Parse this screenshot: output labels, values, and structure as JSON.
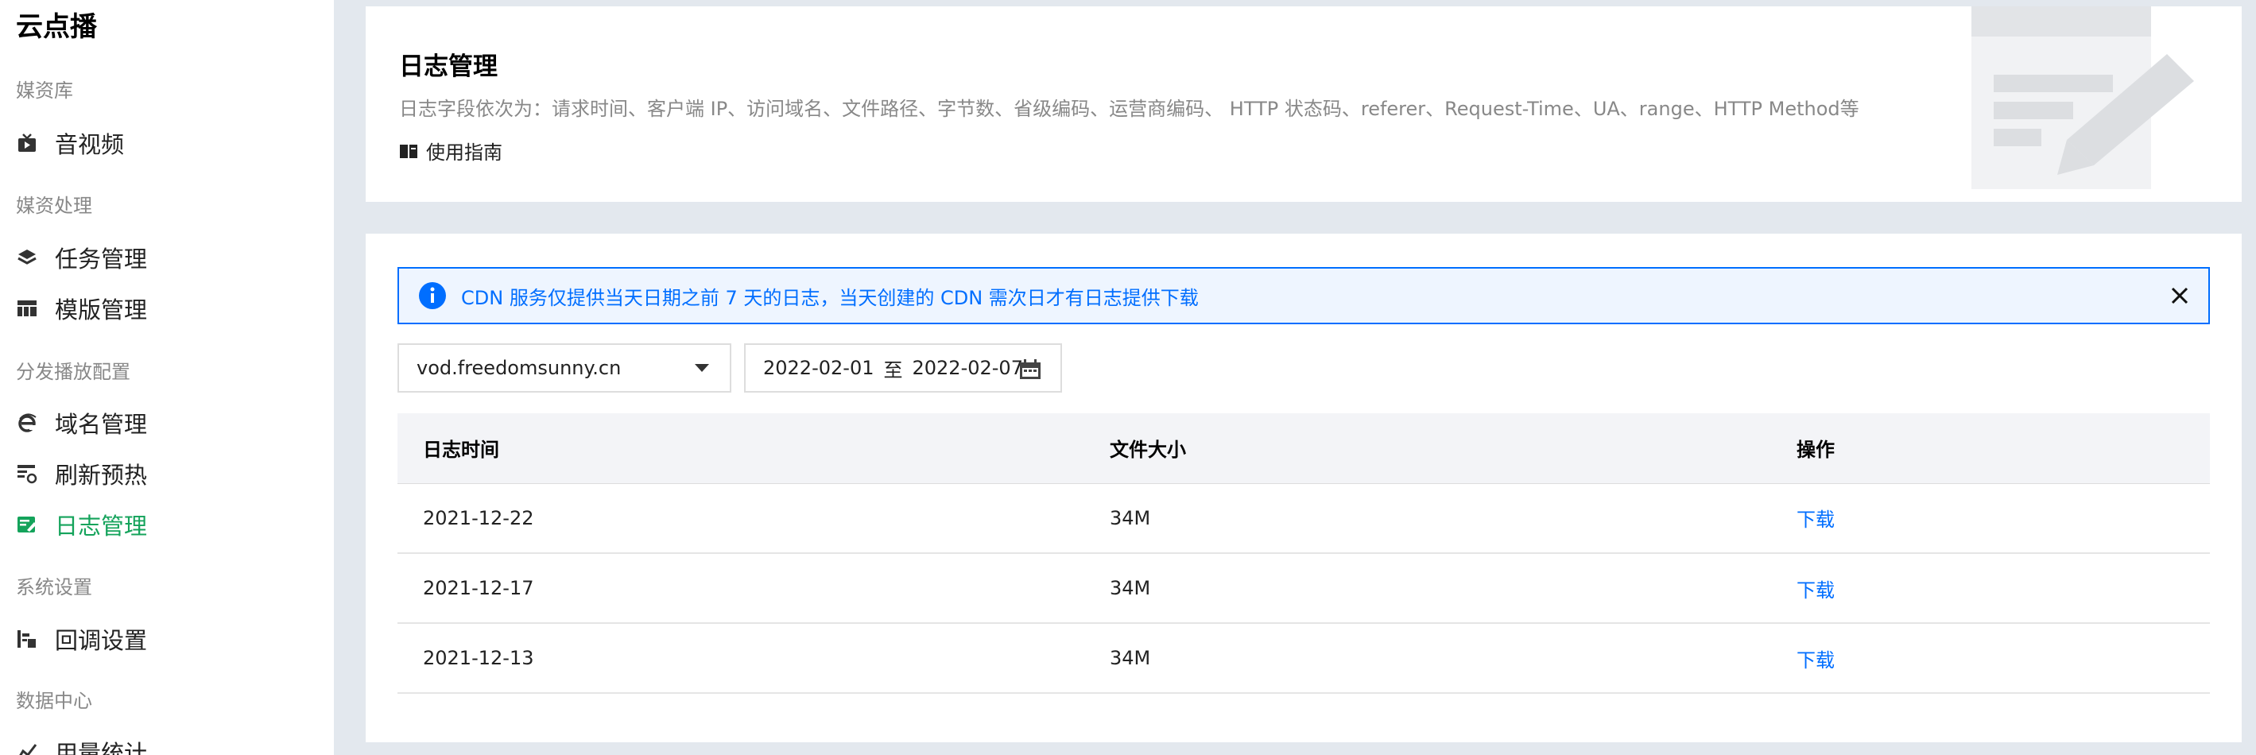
{
  "sidebar": {
    "brand": "云点播",
    "groups": [
      {
        "label": "媒资库",
        "items": [
          {
            "label": "音视频",
            "icon": "video-icon"
          }
        ]
      },
      {
        "label": "媒资处理",
        "items": [
          {
            "label": "任务管理",
            "icon": "layers-icon"
          },
          {
            "label": "模版管理",
            "icon": "template-icon"
          }
        ]
      },
      {
        "label": "分发播放配置",
        "items": [
          {
            "label": "域名管理",
            "icon": "globe-e-icon"
          },
          {
            "label": "刷新预热",
            "icon": "refresh-icon"
          },
          {
            "label": "日志管理",
            "icon": "log-icon",
            "active": true
          }
        ]
      },
      {
        "label": "系统设置",
        "items": [
          {
            "label": "回调设置",
            "icon": "callback-icon"
          }
        ]
      },
      {
        "label": "数据中心",
        "items": [
          {
            "label": "用量统计",
            "icon": "stats-icon"
          }
        ]
      }
    ],
    "active_color": "#14a35b"
  },
  "header": {
    "title": "日志管理",
    "description": "日志字段依次为：请求时间、客户端 IP、访问域名、文件路径、字节数、省级编码、运营商编码、 HTTP 状态码、referer、Request-Time、UA、range、HTTP Method等",
    "guide_label": "使用指南"
  },
  "notice": {
    "text": "CDN 服务仅提供当天日期之前 7 天的日志，当天创建的 CDN 需次日才有日志提供下载",
    "color": "#006eff"
  },
  "filters": {
    "domain": "vod.freedomsunny.cn",
    "date_start": "2022-02-01",
    "date_sep": "至",
    "date_end": "2022-02-07"
  },
  "table": {
    "headers": [
      "日志时间",
      "文件大小",
      "操作"
    ],
    "rows": [
      {
        "time": "2021-12-22",
        "size": "34M",
        "action": "下载"
      },
      {
        "time": "2021-12-17",
        "size": "34M",
        "action": "下载"
      },
      {
        "time": "2021-12-13",
        "size": "34M",
        "action": "下载"
      }
    ]
  }
}
